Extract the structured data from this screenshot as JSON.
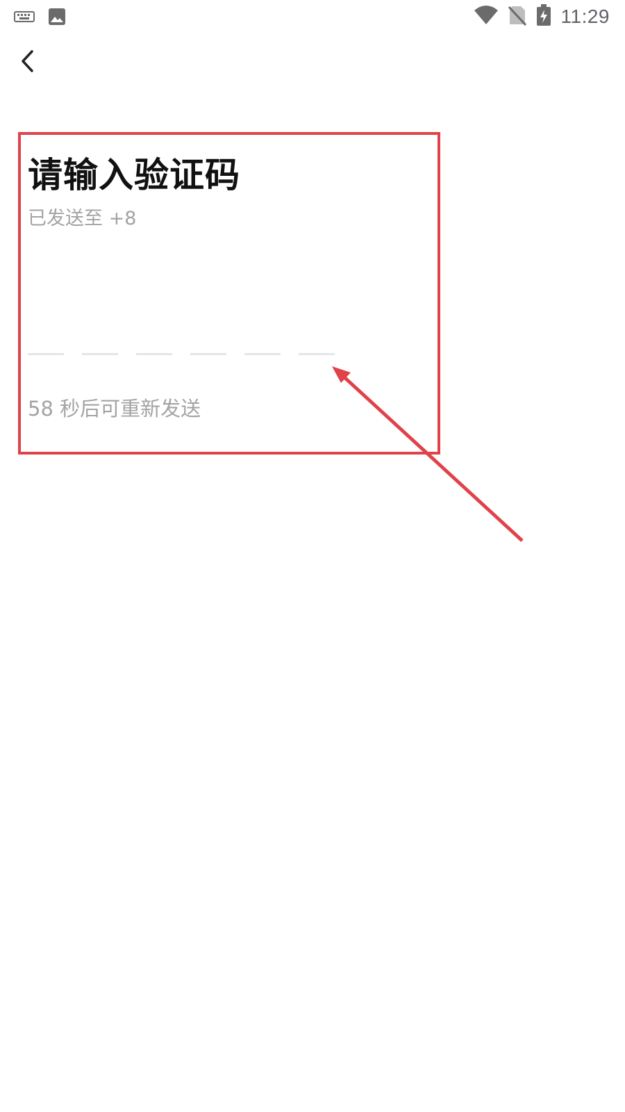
{
  "status_bar": {
    "time": "11:29",
    "left_icons": [
      "keyboard-icon",
      "image-icon"
    ],
    "right_icons": [
      "wifi-icon",
      "no-sim-icon",
      "battery-charging-icon"
    ]
  },
  "nav": {
    "back_icon": "chevron-left-icon"
  },
  "main": {
    "title": "请输入验证码",
    "subtitle": "已发送至 +8",
    "code_slots": [
      "",
      "",
      "",
      "",
      "",
      ""
    ],
    "resend_text": "58 秒后可重新发送"
  },
  "colors": {
    "annotation": "#e0424a",
    "muted_text": "#a3a3a3",
    "slot_line": "#e3e6ea"
  }
}
